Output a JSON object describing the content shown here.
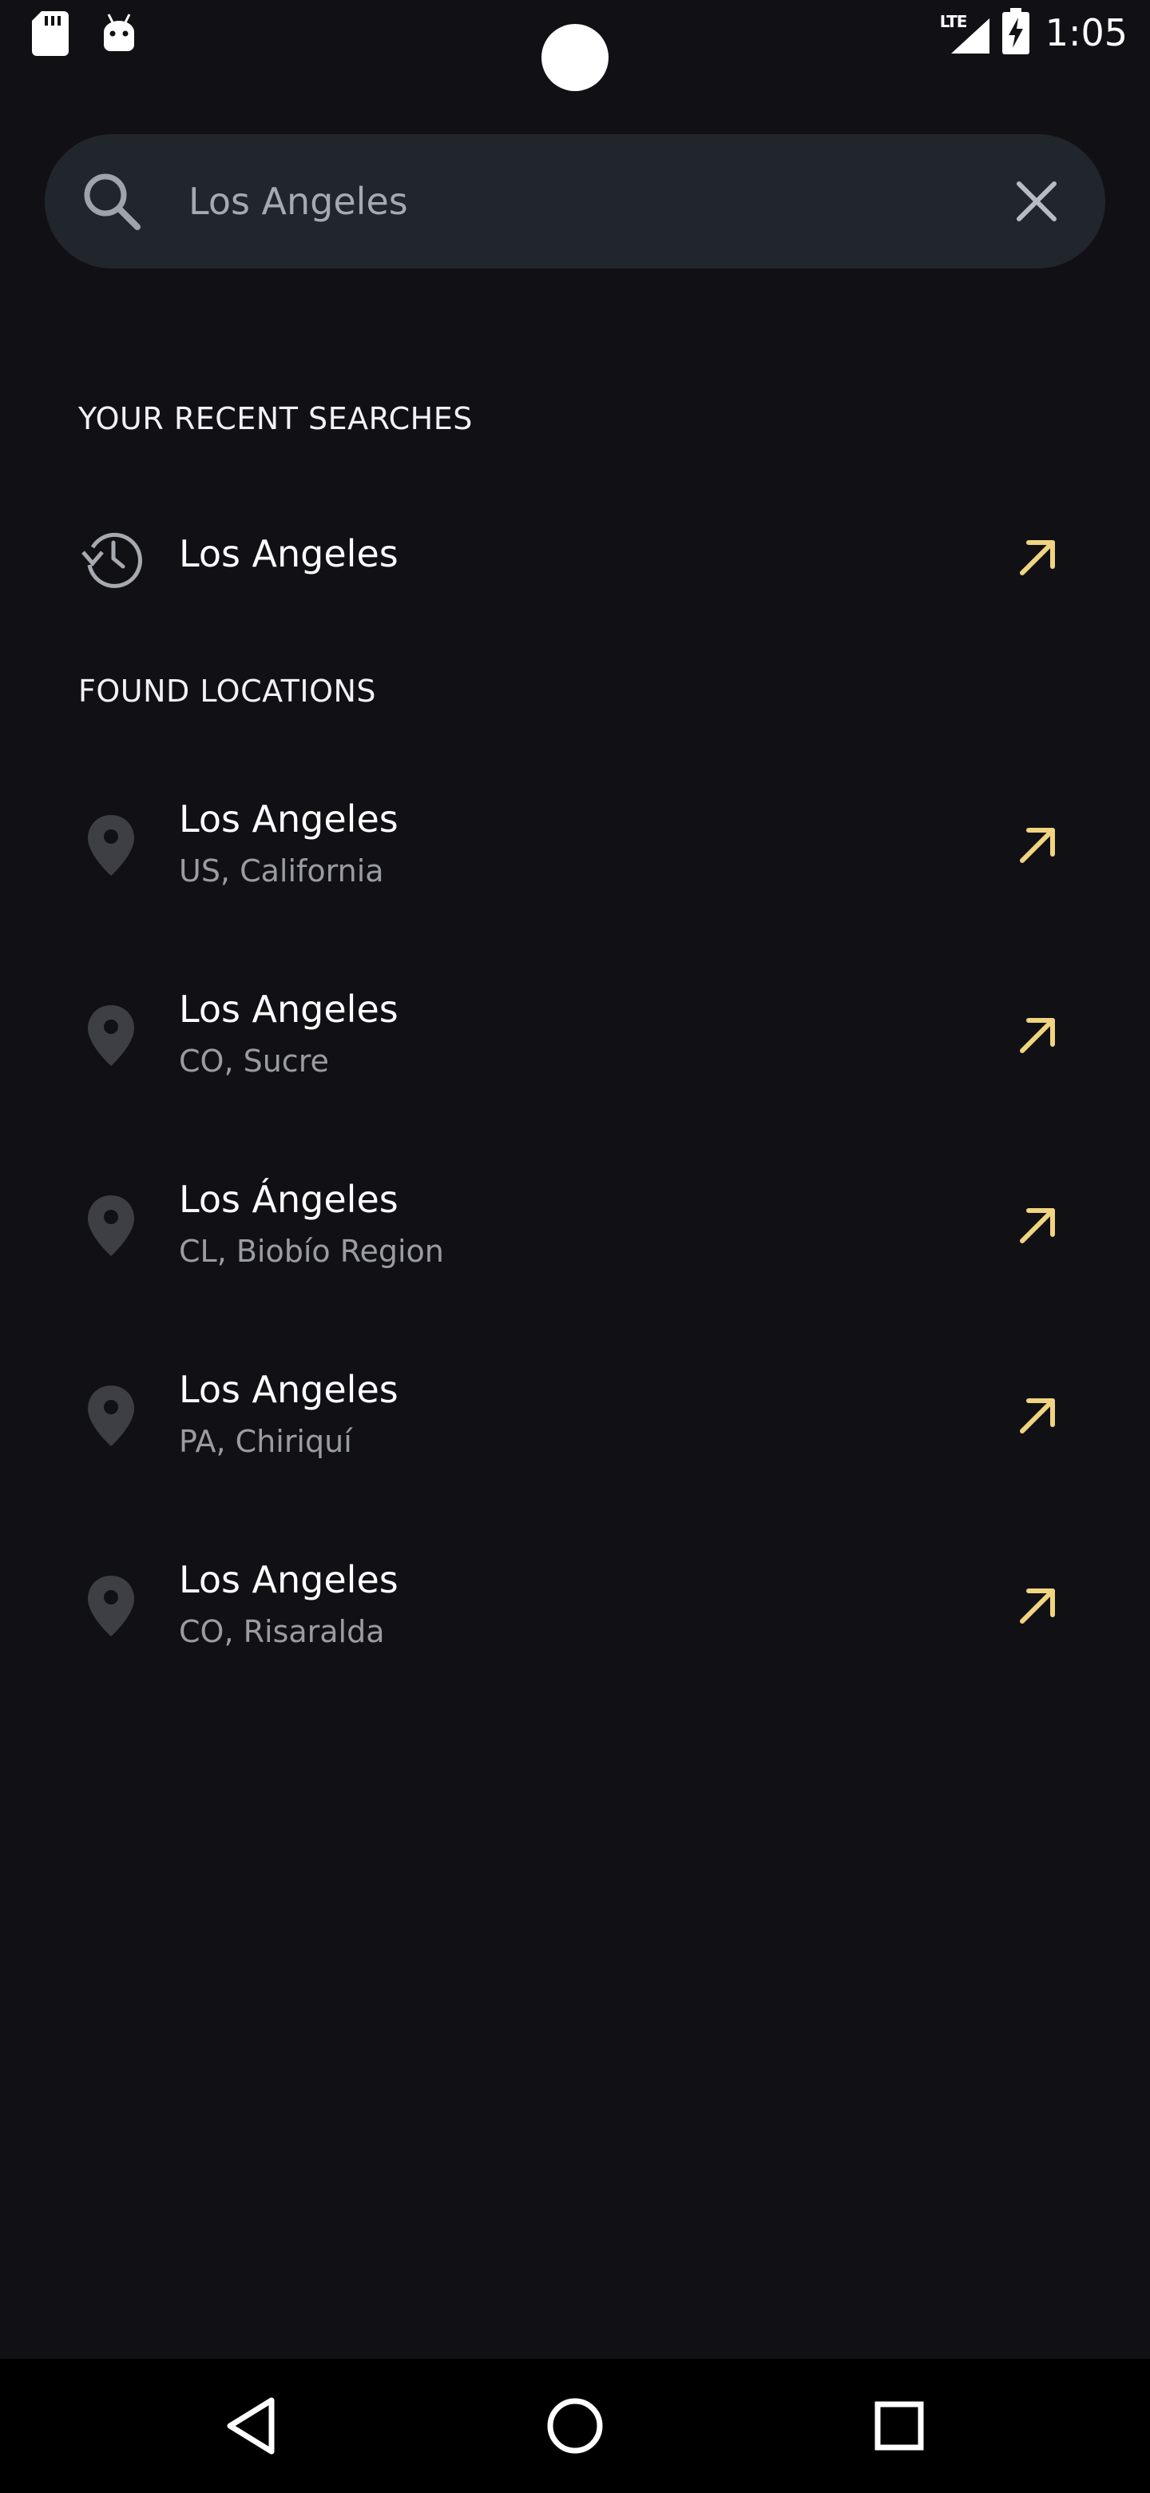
{
  "status_bar": {
    "time": "1:05",
    "network": "LTE",
    "icons": [
      "sd-card-icon",
      "android-icon",
      "lte-signal-icon",
      "battery-charging-icon"
    ]
  },
  "search": {
    "value": "Los Angeles",
    "icon": "search-icon",
    "clear_icon": "close-icon"
  },
  "recent": {
    "title": "YOUR RECENT SEARCHES",
    "items": [
      {
        "name": "Los Angeles",
        "icon": "history-icon"
      }
    ]
  },
  "found": {
    "title": "FOUND LOCATIONS",
    "items": [
      {
        "name": "Los Angeles",
        "region": "US, California",
        "icon": "location-pin-icon"
      },
      {
        "name": "Los Angeles",
        "region": "CO, Sucre",
        "icon": "location-pin-icon"
      },
      {
        "name": "Los Ángeles",
        "region": "CL, Biobío Region",
        "icon": "location-pin-icon"
      },
      {
        "name": "Los Angeles",
        "region": "PA, Chiriquí",
        "icon": "location-pin-icon"
      },
      {
        "name": "Los Angeles",
        "region": "CO, Risaralda",
        "icon": "location-pin-icon"
      }
    ]
  },
  "navigation": {
    "icons": [
      "back-icon",
      "home-icon",
      "recents-icon"
    ]
  },
  "colors": {
    "background": "#111115",
    "search_background": "#21252c",
    "accent_arrow": "#f0d480",
    "secondary_text": "#9b9ca3",
    "icon_grey": "#3e3f44"
  }
}
